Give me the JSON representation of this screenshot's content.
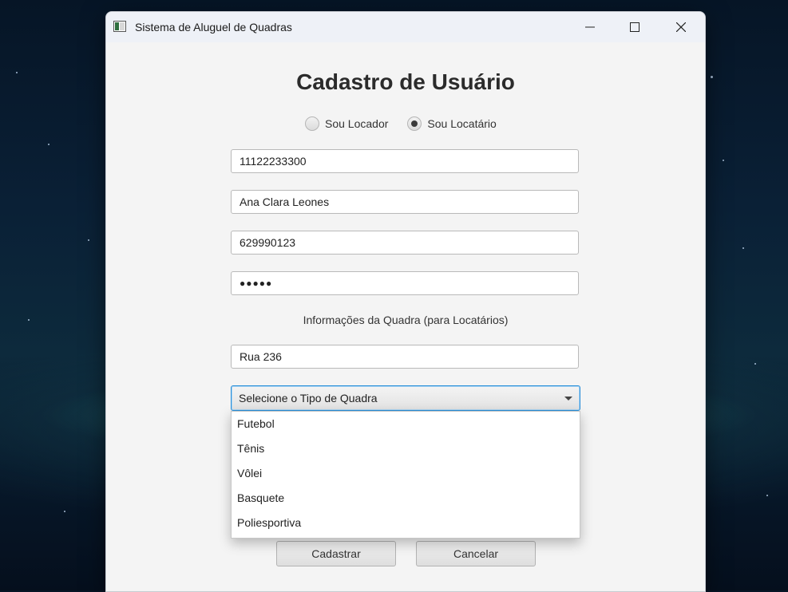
{
  "window": {
    "title": "Sistema de Aluguel de Quadras"
  },
  "form": {
    "heading": "Cadastro de Usuário",
    "radio_options": [
      {
        "label": "Sou Locador",
        "checked": false
      },
      {
        "label": "Sou Locatário",
        "checked": true
      }
    ],
    "fields": {
      "cpf": "11122233300",
      "name": "Ana Clara Leones",
      "phone": "629990123",
      "password_masked": "●●●●●"
    },
    "section_label": "Informações da Quadra (para Locatários)",
    "address": "Rua 236",
    "court_type": {
      "prompt": "Selecione o Tipo de Quadra",
      "options": [
        "Futebol",
        "Tênis",
        "Vôlei",
        "Basquete",
        "Poliesportiva"
      ]
    },
    "buttons": {
      "submit": "Cadastrar",
      "cancel": "Cancelar"
    }
  },
  "colors": {
    "focus_border": "#2a8fd8",
    "window_bg": "#f4f4f4"
  }
}
